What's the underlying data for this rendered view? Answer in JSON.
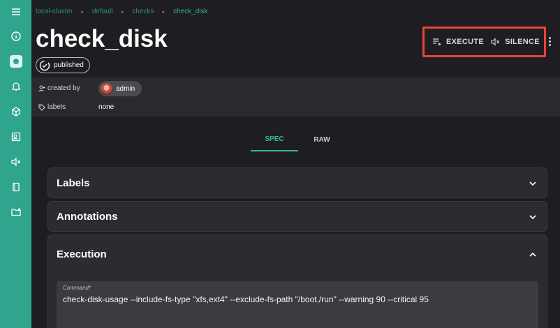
{
  "breadcrumb": {
    "items": [
      "local-cluster",
      "default",
      "checks",
      "check_disk"
    ]
  },
  "page": {
    "title": "check_disk",
    "status": "published"
  },
  "actions": {
    "execute_label": "EXECUTE",
    "silence_label": "SILENCE"
  },
  "meta": {
    "created_by_label": "created by",
    "created_by_value": "admin",
    "labels_label": "labels",
    "labels_value": "none"
  },
  "tabs": {
    "spec": "SPEC",
    "raw": "RAW",
    "active": "SPEC"
  },
  "sections": {
    "labels_title": "Labels",
    "annotations_title": "Annotations",
    "execution_title": "Execution"
  },
  "execution": {
    "command_label": "Command",
    "command_required_marker": "*",
    "command_value": "check-disk-usage --include-fs-type \"xfs,ext4\" --exclude-fs-path \"/boot,/run\" --warning 90 --critical 95"
  },
  "sidebar": {
    "items": [
      "menu-icon",
      "info-icon",
      "dashboard-icon",
      "bell-icon",
      "cube-icon",
      "entity-icon",
      "mute-icon",
      "checklist-icon",
      "folder-icon"
    ]
  },
  "colors": {
    "accent": "#2fa58e",
    "highlight_border": "#e8443c",
    "background": "#1e1e22"
  }
}
